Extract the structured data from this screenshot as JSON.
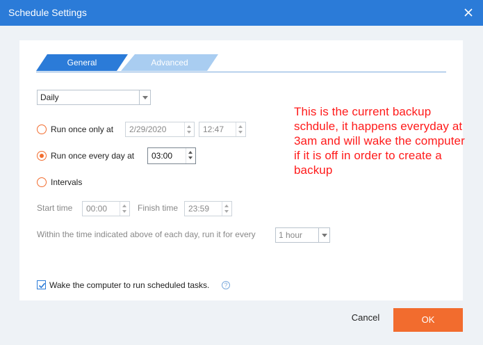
{
  "window": {
    "title": "Schedule Settings"
  },
  "tabs": [
    {
      "label": "General",
      "active": true
    },
    {
      "label": "Advanced",
      "active": false
    }
  ],
  "frequency": {
    "selected": "Daily"
  },
  "options": {
    "run_once_only": {
      "label": "Run once only at",
      "date": "2/29/2020",
      "time": "12:47",
      "checked": false
    },
    "run_once_every_day": {
      "label": "Run once every day at",
      "time": "03:00",
      "checked": true
    },
    "intervals": {
      "label": "Intervals",
      "checked": false
    }
  },
  "interval_settings": {
    "start_label": "Start time",
    "start_value": "00:00",
    "finish_label": "Finish time",
    "finish_value": "23:59",
    "every_label": "Within the time indicated above of each day, run it for every",
    "every_value": "1 hour"
  },
  "wake": {
    "label": "Wake the computer to run scheduled tasks.",
    "checked": true
  },
  "annotation": "This is the current backup schdule, it happens everyday at 3am and will wake the computer if it is off in order to create a backup",
  "buttons": {
    "cancel": "Cancel",
    "ok": "OK"
  },
  "colors": {
    "titlebar": "#2b7bd8",
    "accent": "#f26c2e",
    "annotation": "#ff1a1a"
  }
}
